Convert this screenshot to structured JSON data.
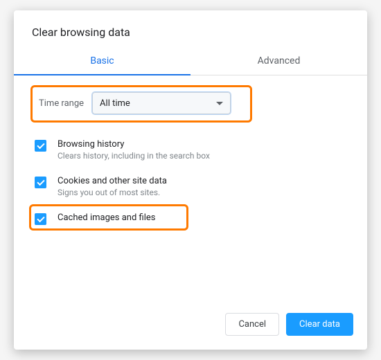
{
  "dialog": {
    "title": "Clear browsing data"
  },
  "tabs": {
    "basic": "Basic",
    "advanced": "Advanced"
  },
  "timerange": {
    "label": "Time range",
    "selected": "All time"
  },
  "options": {
    "browsing_history": {
      "title": "Browsing history",
      "desc": "Clears history, including in the search box"
    },
    "cookies": {
      "title": "Cookies and other site data",
      "desc": "Signs you out of most sites."
    },
    "cached": {
      "title": "Cached images and files"
    }
  },
  "footer": {
    "cancel": "Cancel",
    "clear": "Clear data"
  },
  "colors": {
    "accent": "#1a9cff",
    "highlight": "#ff7a00",
    "link": "#1a73e8"
  }
}
